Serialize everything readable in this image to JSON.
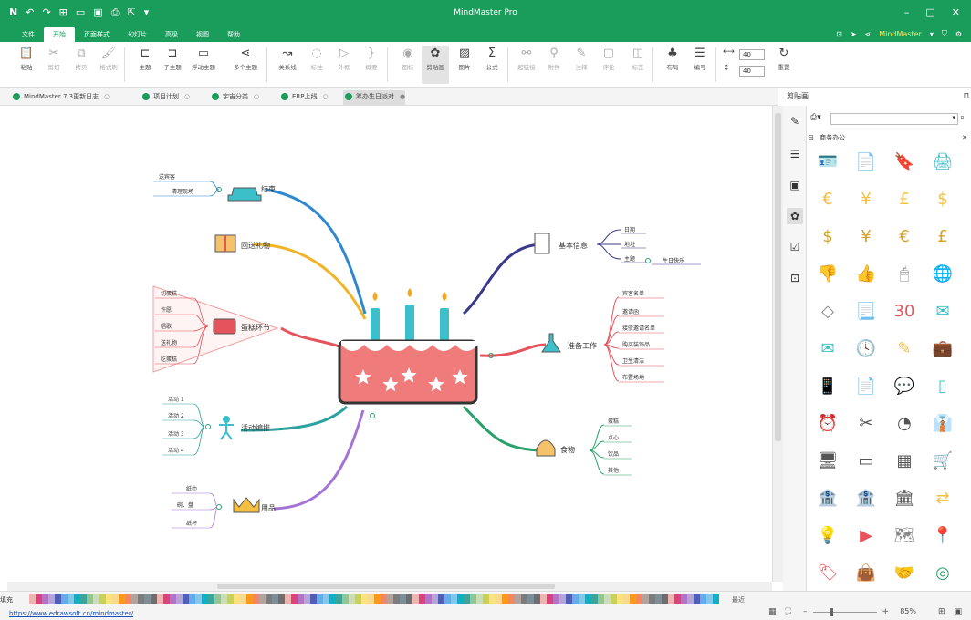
{
  "app": {
    "title": "MindMaster Pro",
    "brand": "MindMaster"
  },
  "menu": [
    "文件",
    "开始",
    "页面样式",
    "幻灯片",
    "高级",
    "视图",
    "帮助"
  ],
  "active_menu": "开始",
  "ribbon": [
    {
      "label": "粘贴",
      "icon": "paste-icon",
      "dim": false
    },
    {
      "label": "剪切",
      "icon": "cut-icon",
      "dim": true
    },
    {
      "label": "拷贝",
      "icon": "copy-icon",
      "dim": true
    },
    {
      "label": "格式刷",
      "icon": "format-brush-icon",
      "dim": true
    },
    {
      "label": "主题",
      "icon": "topic-icon",
      "dim": false
    },
    {
      "label": "子主题",
      "icon": "subtopic-icon",
      "dim": false
    },
    {
      "label": "浮动主题",
      "icon": "floating-topic-icon",
      "dim": false
    },
    {
      "label": "多个主题",
      "icon": "multiple-topics-icon",
      "dim": false
    },
    {
      "label": "关系线",
      "icon": "relationship-icon",
      "dim": false
    },
    {
      "label": "标注",
      "icon": "callout-icon",
      "dim": true
    },
    {
      "label": "外框",
      "icon": "boundary-icon",
      "dim": true
    },
    {
      "label": "概要",
      "icon": "summary-icon",
      "dim": true
    },
    {
      "label": "图标",
      "icon": "mark-icon",
      "dim": true
    },
    {
      "label": "剪贴画",
      "icon": "clipart-icon",
      "dim": false,
      "selected": true
    },
    {
      "label": "图片",
      "icon": "picture-icon",
      "dim": false
    },
    {
      "label": "公式",
      "icon": "formula-icon",
      "dim": false
    },
    {
      "label": "超链接",
      "icon": "hyperlink-icon",
      "dim": true
    },
    {
      "label": "附件",
      "icon": "attachment-icon",
      "dim": true
    },
    {
      "label": "注释",
      "icon": "note-icon",
      "dim": true
    },
    {
      "label": "评论",
      "icon": "comment-icon",
      "dim": true
    },
    {
      "label": "标签",
      "icon": "tag-icon",
      "dim": true
    },
    {
      "label": "布局",
      "icon": "layout-icon",
      "dim": false
    },
    {
      "label": "编号",
      "icon": "numbering-icon",
      "dim": false
    },
    {
      "label": "重置",
      "icon": "reset-icon",
      "dim": false
    }
  ],
  "spacing": {
    "h": "40",
    "v": "40"
  },
  "doc_tabs": [
    {
      "label": "MindMaster 7.3更新日志"
    },
    {
      "label": "项目计划"
    },
    {
      "label": "宇宙分类"
    },
    {
      "label": "ERP上线"
    },
    {
      "label": "筹办生日派对",
      "active": true
    }
  ],
  "mindmap": {
    "branches": {
      "base": {
        "label": "基本信息",
        "items": [
          "日期",
          "地址",
          "主题"
        ],
        "extra": "生日快乐"
      },
      "prep": {
        "label": "准备工作",
        "items": [
          "宾客名单",
          "邀请函",
          "接驳邀请名单",
          "购买装饰品",
          "卫生清洁",
          "布置场地"
        ]
      },
      "food": {
        "label": "食物",
        "items": [
          "蛋糕",
          "点心",
          "饮品",
          "其他"
        ]
      },
      "end": {
        "label": "结束",
        "items": [
          "送宾客",
          "清理现场"
        ]
      },
      "gift": {
        "label": "回送礼物",
        "items": []
      },
      "cake": {
        "label": "蛋糕环节",
        "items": [
          "切蛋糕",
          "许愿",
          "唱歌",
          "送礼物",
          "吃蛋糕"
        ]
      },
      "act": {
        "label": "活动编排",
        "items": [
          "活动 1",
          "活动 2",
          "活动 3",
          "活动 4"
        ]
      },
      "supply": {
        "label": "用品",
        "items": [
          "纸巾",
          "碗、盘",
          "纸杯"
        ]
      }
    }
  },
  "panel": {
    "title": "剪贴画",
    "category": "商务办公",
    "search_placeholder": ""
  },
  "clipart": [
    "id-badge",
    "resume",
    "stamp",
    "printer",
    "euro-coin",
    "yen-coin",
    "pound-coin",
    "dollar-coin",
    "dollar-bag",
    "yen-bag",
    "euro-bag",
    "pound-bag",
    "thumbs-down",
    "thumbs-up",
    "mouse",
    "globe",
    "diamond",
    "document",
    "calendar-30",
    "open-mail",
    "mail",
    "clock",
    "pencil",
    "briefcase",
    "phone",
    "paper",
    "chat",
    "tablet",
    "alarm-clock",
    "scissors",
    "gauge",
    "shirt-tie",
    "monitor",
    "laptop",
    "card-machine",
    "tablet-cart",
    "bank-user",
    "bank-yen",
    "bank",
    "currency-exchange",
    "idea",
    "presentation",
    "map",
    "location-pin",
    "tag",
    "shopping-bag",
    "handshake",
    "target"
  ],
  "status": {
    "fill_label": "填充",
    "recent_label": "最近",
    "url": "https://www.edrawsoft.cn/mindmaster/",
    "zoom": "85%"
  },
  "colors": {
    "brand": "#1a9c5b",
    "cake": "#f07b7b",
    "candle": "#3dbfc9"
  }
}
